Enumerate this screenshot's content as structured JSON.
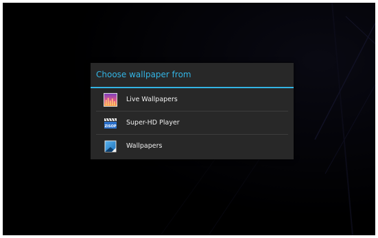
{
  "dialog": {
    "title": "Choose wallpaper from",
    "items": [
      {
        "label": "Live Wallpapers",
        "icon": "live-wallpapers-icon"
      },
      {
        "label": "Super-HD Player",
        "icon": "super-hd-player-icon",
        "icon_text": "ZISOP"
      },
      {
        "label": "Wallpapers",
        "icon": "wallpapers-icon"
      }
    ]
  },
  "colors": {
    "accent": "#33b5e5",
    "dialog_bg": "#282828",
    "text": "#f0f0f0",
    "divider": "#3d3d3d",
    "screen_bg": "#000000"
  }
}
